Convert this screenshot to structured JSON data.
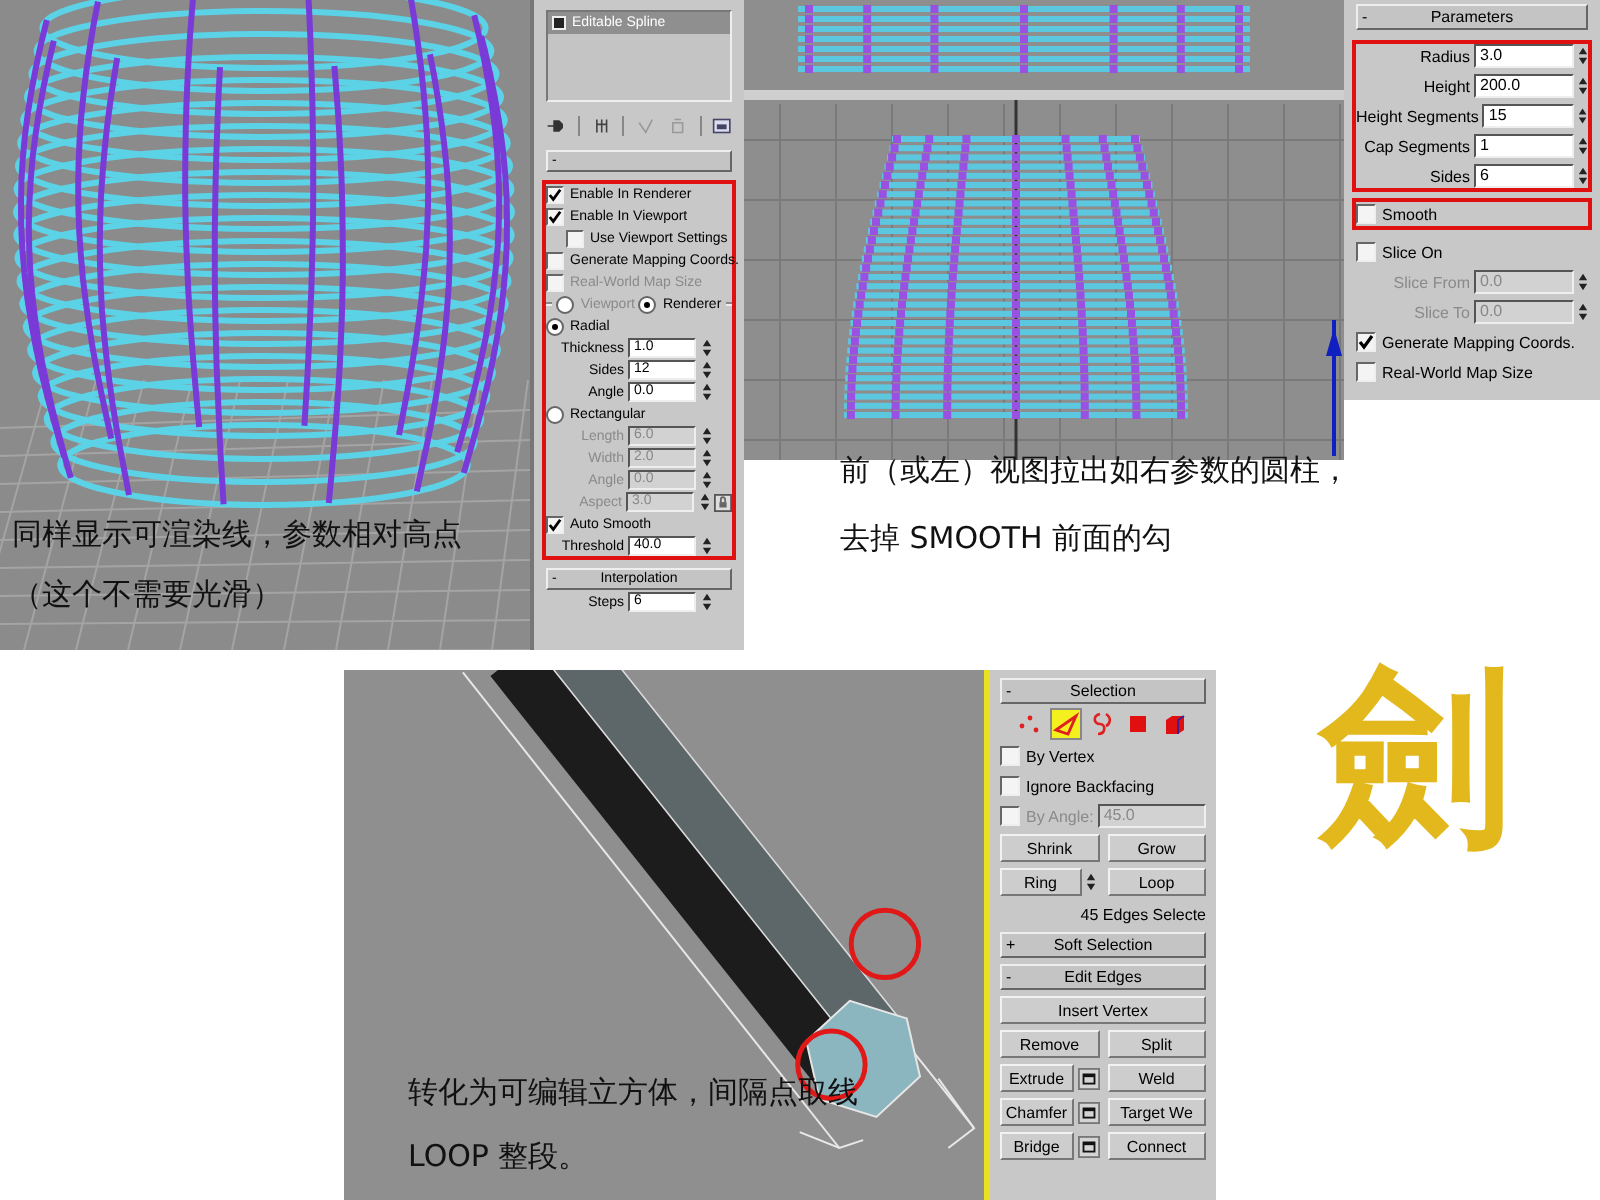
{
  "spline_view": {
    "caption": [
      "同样显示可渲染线，参数相对高点",
      "（这个不需要光滑）"
    ],
    "panel": {
      "sections": [
        {
          "highlighted": false,
          "rows": [
            {
              "kind": "stack",
              "items": [
                {
                  "label": "Editable Spline",
                  "selected": true
                }
              ]
            },
            {
              "kind": "stack_tools"
            },
            {
              "kind": "rollout",
              "sign": "-"
            }
          ]
        },
        {
          "highlighted": true,
          "rows": [
            {
              "kind": "checkbox",
              "label": "Enable In Renderer",
              "checked": true,
              "disabled": false
            },
            {
              "kind": "checkbox",
              "label": "Enable In Viewport",
              "checked": true,
              "disabled": false,
              "children": [
                {
                  "kind": "checkbox",
                  "label": "Use Viewport Settings",
                  "checked": false,
                  "disabled": false
                }
              ]
            },
            {
              "kind": "checkbox",
              "label": "Generate Mapping Coords.",
              "checked": false,
              "disabled": false
            },
            {
              "kind": "checkbox",
              "label": "Real-World Map Size",
              "checked": false,
              "disabled": true
            },
            {
              "kind": "radio_group",
              "options": [
                {
                  "label": "Viewport",
                  "selected": false,
                  "disabled": true
                },
                {
                  "label": "Renderer",
                  "selected": true,
                  "disabled": false
                }
              ]
            },
            {
              "kind": "radio",
              "label": "Radial",
              "selected": true,
              "disabled": false
            },
            {
              "kind": "spinner",
              "label": "Thickness",
              "value": "1.0",
              "disabled": false
            },
            {
              "kind": "spinner",
              "label": "Sides",
              "value": "12",
              "disabled": false
            },
            {
              "kind": "spinner",
              "label": "Angle",
              "value": "0.0",
              "disabled": false
            },
            {
              "kind": "radio",
              "label": "Rectangular",
              "selected": false,
              "disabled": false
            },
            {
              "kind": "spinner",
              "label": "Length",
              "value": "6.0",
              "disabled": true
            },
            {
              "kind": "spinner",
              "label": "Width",
              "value": "2.0",
              "disabled": true
            },
            {
              "kind": "spinner",
              "label": "Angle",
              "value": "0.0",
              "disabled": true
            },
            {
              "kind": "spinner",
              "label": "Aspect",
              "value": "3.0",
              "disabled": true,
              "lock": true
            },
            {
              "kind": "checkbox",
              "label": "Auto Smooth",
              "checked": true,
              "disabled": false
            },
            {
              "kind": "spinner",
              "label": "Threshold",
              "value": "40.0",
              "disabled": false
            }
          ]
        },
        {
          "highlighted": false,
          "rows": [
            {
              "kind": "rollout",
              "sign": "-",
              "title": "Interpolation"
            },
            {
              "kind": "spinner",
              "label": "Steps",
              "value": "6",
              "disabled": false
            }
          ]
        }
      ]
    }
  },
  "cylinder_view": {
    "caption": [
      "前（或左）视图拉出如右参数的圆柱，",
      "去掉 SMOOTH 前面的勾"
    ],
    "panel": {
      "sections": [
        {
          "highlighted": false,
          "rows": [
            {
              "kind": "rollout",
              "sign": "-",
              "title": "Parameters"
            }
          ]
        },
        {
          "highlighted": true,
          "rows": [
            {
              "kind": "spinner",
              "label": "Radius",
              "value": "3.0",
              "disabled": false
            },
            {
              "kind": "spinner",
              "label": "Height",
              "value": "200.0",
              "disabled": false
            },
            {
              "kind": "spinner",
              "label": "Height Segments",
              "value": "15",
              "disabled": false
            },
            {
              "kind": "spinner",
              "label": "Cap Segments",
              "value": "1",
              "disabled": false
            },
            {
              "kind": "spinner",
              "label": "Sides",
              "value": "6",
              "disabled": false
            }
          ]
        },
        {
          "highlighted": true,
          "rows": [
            {
              "kind": "checkbox",
              "label": "Smooth",
              "checked": false,
              "disabled": false
            }
          ]
        },
        {
          "highlighted": false,
          "rows": [
            {
              "kind": "checkbox",
              "label": "Slice On",
              "checked": false,
              "disabled": false
            },
            {
              "kind": "spinner",
              "label": "Slice From",
              "value": "0.0",
              "disabled": true
            },
            {
              "kind": "spinner",
              "label": "Slice To",
              "value": "0.0",
              "disabled": true
            },
            {
              "kind": "checkbox",
              "label": "Generate Mapping Coords.",
              "checked": true,
              "disabled": false
            },
            {
              "kind": "checkbox",
              "label": "Real-World Map Size",
              "checked": false,
              "disabled": false
            }
          ]
        }
      ]
    }
  },
  "edge_view": {
    "caption": [
      "转化为可编辑立方体，间隔点取线",
      "LOOP 整段。"
    ],
    "panel": {
      "sections": [
        {
          "highlighted": false,
          "rows": [
            {
              "kind": "rollout",
              "sign": "-",
              "title": "Selection"
            },
            {
              "kind": "subobject_icons",
              "icons": [
                {
                  "kind": "vertex",
                  "selected": false
                },
                {
                  "kind": "edge",
                  "selected": true
                },
                {
                  "kind": "border",
                  "selected": false
                },
                {
                  "kind": "polygon",
                  "selected": false
                },
                {
                  "kind": "element",
                  "selected": false
                }
              ]
            },
            {
              "kind": "checkbox",
              "label": "By Vertex",
              "checked": false,
              "disabled": false
            },
            {
              "kind": "checkbox",
              "label": "Ignore Backfacing",
              "checked": false,
              "disabled": false
            },
            {
              "kind": "checkbox",
              "label": "By Angle:",
              "checked": false,
              "disabled": true,
              "value": "45.0"
            },
            {
              "kind": "buttons",
              "buttons": [
                {
                  "label": "Shrink"
                },
                {
                  "label": "Grow"
                }
              ]
            },
            {
              "kind": "buttons",
              "buttons": [
                {
                  "label": "Ring",
                  "spinner": true
                },
                {
                  "label": "Loop"
                }
              ]
            },
            {
              "kind": "text",
              "text": "45 Edges Selecte"
            },
            {
              "kind": "rollout",
              "sign": "+",
              "title": "Soft Selection"
            },
            {
              "kind": "rollout",
              "sign": "-",
              "title": "Edit Edges"
            },
            {
              "kind": "buttons",
              "buttons": [
                {
                  "label": "Insert Vertex"
                }
              ]
            },
            {
              "kind": "buttons",
              "buttons": [
                {
                  "label": "Remove"
                },
                {
                  "label": "Split"
                }
              ]
            },
            {
              "kind": "buttons",
              "buttons": [
                {
                  "label": "Extrude",
                  "settings": true
                },
                {
                  "label": "Weld"
                }
              ]
            },
            {
              "kind": "buttons",
              "buttons": [
                {
                  "label": "Chamfer",
                  "settings": true
                },
                {
                  "label": "Target We"
                }
              ]
            },
            {
              "kind": "buttons",
              "buttons": [
                {
                  "label": "Bridge",
                  "settings": true
                },
                {
                  "label": "Connect"
                }
              ]
            }
          ]
        }
      ]
    }
  },
  "logo": "劍"
}
